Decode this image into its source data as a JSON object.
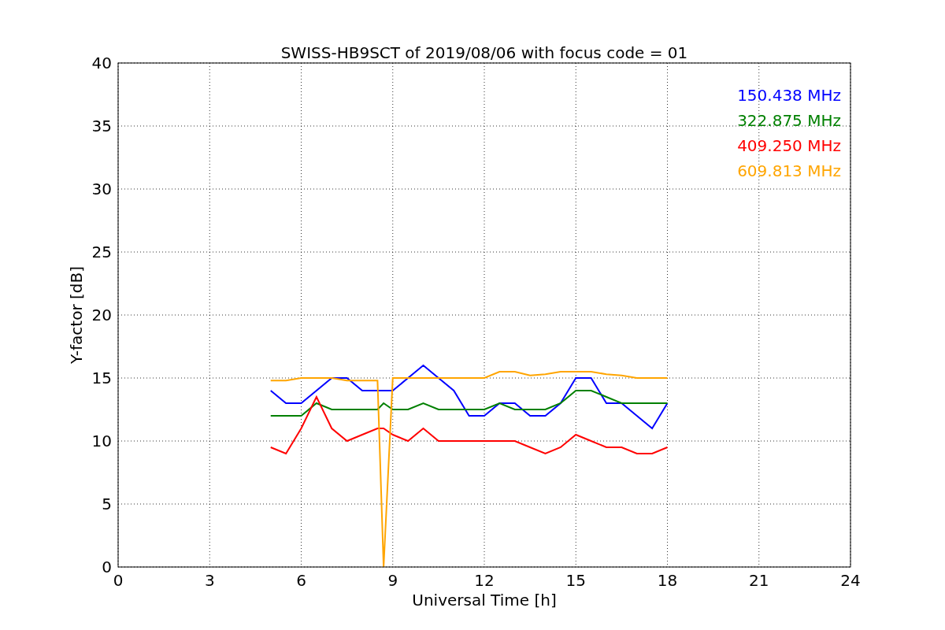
{
  "figure": {
    "chart_data": {
      "type": "line",
      "title": "SWISS-HB9SCT of 2019/08/06 with focus code = 01",
      "xlabel": "Universal Time [h]",
      "ylabel": "Y-factor [dB]",
      "xlim": [
        0,
        24
      ],
      "ylim": [
        0,
        40
      ],
      "xticks": [
        0,
        3,
        6,
        9,
        12,
        15,
        18,
        21,
        24
      ],
      "yticks": [
        0,
        5,
        10,
        15,
        20,
        25,
        30,
        35,
        40
      ],
      "grid": true,
      "x": [
        5,
        5.5,
        6,
        6.5,
        7,
        7.5,
        8,
        8.5,
        8.7,
        9,
        9.5,
        10,
        10.5,
        11,
        11.5,
        12,
        12.5,
        13,
        13.5,
        14,
        14.5,
        15,
        15.5,
        16,
        16.5,
        17,
        17.5,
        18
      ],
      "series": [
        {
          "name": "150.438 MHz",
          "color": "#0000ff",
          "values": [
            14,
            13,
            13,
            14,
            15,
            15,
            14,
            14,
            14,
            14,
            15,
            16,
            15,
            14,
            12,
            12,
            13,
            13,
            12,
            12,
            13,
            15,
            15,
            13,
            13,
            12,
            11,
            13
          ]
        },
        {
          "name": "322.875 MHz",
          "color": "#008000",
          "values": [
            12,
            12,
            12,
            13,
            12.5,
            12.5,
            12.5,
            12.5,
            13,
            12.5,
            12.5,
            13,
            12.5,
            12.5,
            12.5,
            12.5,
            13,
            12.5,
            12.5,
            12.5,
            13,
            14,
            14,
            13.5,
            13,
            13,
            13,
            13
          ]
        },
        {
          "name": "409.250 MHz",
          "color": "#ff0000",
          "values": [
            9.5,
            9,
            11,
            13.5,
            11,
            10,
            10.5,
            11,
            11,
            10.5,
            10,
            11,
            10,
            10,
            10,
            10,
            10,
            10,
            9.5,
            9,
            9.5,
            10.5,
            10,
            9.5,
            9.5,
            9,
            9,
            9.5
          ]
        },
        {
          "name": "609.813 MHz",
          "color": "#ffa500",
          "values": [
            14.8,
            14.8,
            15,
            15,
            15,
            14.8,
            14.8,
            14.8,
            0,
            15,
            15,
            15,
            15,
            15,
            15,
            15,
            15.5,
            15.5,
            15.2,
            15.3,
            15.5,
            15.5,
            15.5,
            15.3,
            15.2,
            15,
            15,
            15
          ]
        }
      ]
    }
  }
}
